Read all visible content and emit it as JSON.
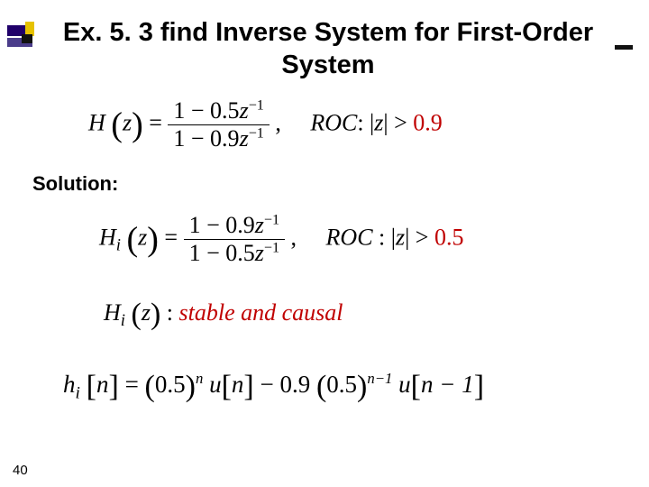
{
  "slide": {
    "title": "Ex. 5. 3 find Inverse System for First-Order System",
    "solution_label": "Solution:",
    "page_number": "40"
  },
  "equations": {
    "H": {
      "lhs": "H",
      "arg": "z",
      "num_text": "1 − 0.5",
      "num_var": "z",
      "num_exp": "−1",
      "den_text": "1 − 0.9",
      "den_var": "z",
      "den_exp": "−1",
      "roc_label": "ROC",
      "roc_mid": ": |",
      "roc_var": "z",
      "roc_after": "| > ",
      "roc_value": "0.9"
    },
    "Hi": {
      "lhs": "H",
      "sub": "i",
      "arg": "z",
      "num_text": "1 − 0.9",
      "num_var": "z",
      "num_exp": "−1",
      "den_text": "1 − 0.5",
      "den_var": "z",
      "den_exp": "−1",
      "roc_label": "ROC",
      "roc_mid": " : |",
      "roc_var": "z",
      "roc_after": "| > ",
      "roc_value": "0.5"
    },
    "Hi_property": {
      "lhs": "H",
      "sub": "i",
      "arg": "z",
      "colon": ": ",
      "text": "stable and causal"
    },
    "hi": {
      "lhs": "h",
      "sub": "i",
      "arg": "n",
      "eq": " = ",
      "t1_open": "(",
      "t1_base": "0.5",
      "t1_close": ")",
      "t1_exp": "n",
      "u1": " u",
      "u1_arg_open": "[",
      "u1_arg": "n",
      "u1_arg_close": "]",
      "minus": " − ",
      "c2": "0.9",
      "t2_open": "(",
      "t2_base": "0.5",
      "t2_close": ")",
      "t2_exp": "n−1",
      "u2": " u",
      "u2_arg_open": "[",
      "u2_arg": "n − 1",
      "u2_arg_close": "]"
    }
  }
}
